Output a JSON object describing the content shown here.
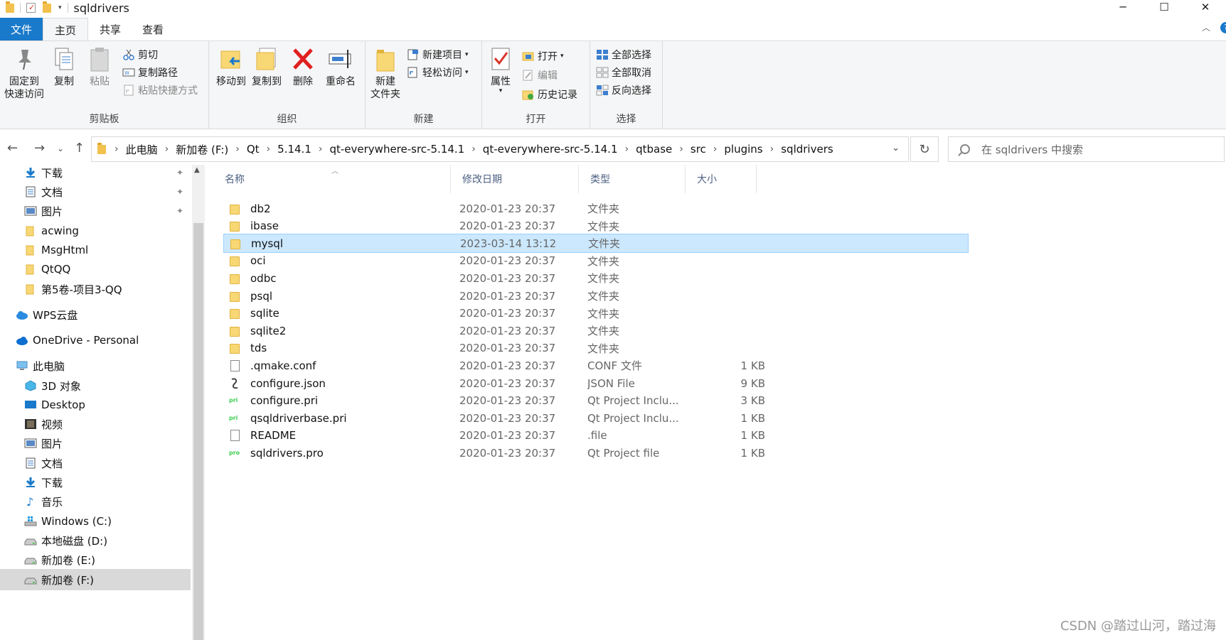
{
  "window": {
    "title": "sqldrivers",
    "minimize_glyph": "─",
    "maximize_glyph": "☐",
    "close_glyph": "✕"
  },
  "ribbon_tabs": [
    {
      "label": "文件"
    },
    {
      "label": "主页"
    },
    {
      "label": "共享"
    },
    {
      "label": "查看"
    }
  ],
  "ribbon": {
    "clipboard": {
      "label": "剪贴板",
      "pin_line1": "固定到",
      "pin_line2": "快速访问",
      "copy": "复制",
      "paste": "粘贴",
      "cut": "剪切",
      "copy_path": "复制路径",
      "paste_shortcut": "粘贴快捷方式"
    },
    "organize": {
      "label": "组织",
      "move_to": "移动到",
      "copy_to": "复制到",
      "delete": "删除",
      "rename": "重命名"
    },
    "new": {
      "label": "新建",
      "new_folder_line1": "新建",
      "new_folder_line2": "文件夹",
      "new_item": "新建项目",
      "easy_access": "轻松访问"
    },
    "open": {
      "label": "打开",
      "properties": "属性",
      "open": "打开",
      "edit": "编辑",
      "history": "历史记录"
    },
    "select": {
      "label": "选择",
      "select_all": "全部选择",
      "select_none": "全部取消",
      "invert": "反向选择"
    }
  },
  "address": {
    "crumbs": [
      "此电脑",
      "新加卷 (F:)",
      "Qt",
      "5.14.1",
      "qt-everywhere-src-5.14.1",
      "qt-everywhere-src-5.14.1",
      "qtbase",
      "src",
      "plugins",
      "sqldrivers"
    ]
  },
  "search": {
    "placeholder": "在 sqldrivers 中搜索"
  },
  "nav_pane": [
    {
      "label": "下载",
      "icon": "download-icon",
      "pinned": true
    },
    {
      "label": "文档",
      "icon": "document-icon",
      "pinned": true
    },
    {
      "label": "图片",
      "icon": "picture-icon",
      "pinned": true
    },
    {
      "label": "acwing",
      "icon": "folder-icon",
      "pinned": false
    },
    {
      "label": "MsgHtml",
      "icon": "folder-icon",
      "pinned": false
    },
    {
      "label": "QtQQ",
      "icon": "folder-icon",
      "pinned": false
    },
    {
      "label": "第5卷-项目3-QQ",
      "icon": "folder-icon",
      "pinned": false
    },
    {
      "label": "WPS云盘",
      "icon": "cloud-icon",
      "pinned": false
    },
    {
      "label": "OneDrive - Personal",
      "icon": "onedrive-icon",
      "pinned": false
    },
    {
      "label": "此电脑",
      "icon": "computer-icon",
      "pinned": false
    },
    {
      "label": "3D 对象",
      "icon": "3d-objects-icon",
      "pinned": false
    },
    {
      "label": "Desktop",
      "icon": "desktop-icon",
      "pinned": false
    },
    {
      "label": "视频",
      "icon": "video-icon",
      "pinned": false
    },
    {
      "label": "图片",
      "icon": "picture-icon",
      "pinned": false
    },
    {
      "label": "文档",
      "icon": "document-icon",
      "pinned": false
    },
    {
      "label": "下载",
      "icon": "download-icon",
      "pinned": false
    },
    {
      "label": "音乐",
      "icon": "music-icon",
      "pinned": false
    },
    {
      "label": "Windows (C:)",
      "icon": "windows-drive-icon",
      "pinned": false
    },
    {
      "label": "本地磁盘 (D:)",
      "icon": "drive-icon",
      "pinned": false
    },
    {
      "label": "新加卷 (E:)",
      "icon": "drive-icon",
      "pinned": false
    },
    {
      "label": "新加卷 (F:)",
      "icon": "drive-icon",
      "pinned": false
    }
  ],
  "columns": {
    "name": "名称",
    "date": "修改日期",
    "type": "类型",
    "size": "大小"
  },
  "files": [
    {
      "name": "db2",
      "date": "2020-01-23 20:37",
      "type": "文件夹",
      "size": "",
      "icon": "folder-icon"
    },
    {
      "name": "ibase",
      "date": "2020-01-23 20:37",
      "type": "文件夹",
      "size": "",
      "icon": "folder-icon"
    },
    {
      "name": "mysql",
      "date": "2023-03-14 13:12",
      "type": "文件夹",
      "size": "",
      "icon": "folder-icon"
    },
    {
      "name": "oci",
      "date": "2020-01-23 20:37",
      "type": "文件夹",
      "size": "",
      "icon": "folder-icon"
    },
    {
      "name": "odbc",
      "date": "2020-01-23 20:37",
      "type": "文件夹",
      "size": "",
      "icon": "folder-icon"
    },
    {
      "name": "psql",
      "date": "2020-01-23 20:37",
      "type": "文件夹",
      "size": "",
      "icon": "folder-icon"
    },
    {
      "name": "sqlite",
      "date": "2020-01-23 20:37",
      "type": "文件夹",
      "size": "",
      "icon": "folder-icon"
    },
    {
      "name": "sqlite2",
      "date": "2020-01-23 20:37",
      "type": "文件夹",
      "size": "",
      "icon": "folder-icon"
    },
    {
      "name": "tds",
      "date": "2020-01-23 20:37",
      "type": "文件夹",
      "size": "",
      "icon": "folder-icon"
    },
    {
      "name": ".qmake.conf",
      "date": "2020-01-23 20:37",
      "type": "CONF 文件",
      "size": "1 KB",
      "icon": "file-icon"
    },
    {
      "name": "configure.json",
      "date": "2020-01-23 20:37",
      "type": "JSON File",
      "size": "9 KB",
      "icon": "json-file-icon"
    },
    {
      "name": "configure.pri",
      "date": "2020-01-23 20:37",
      "type": "Qt Project Inclu...",
      "size": "3 KB",
      "icon": "pri-file-icon"
    },
    {
      "name": "qsqldriverbase.pri",
      "date": "2020-01-23 20:37",
      "type": "Qt Project Inclu...",
      "size": "1 KB",
      "icon": "pri-file-icon"
    },
    {
      "name": "README",
      "date": "2020-01-23 20:37",
      "type": ".file",
      "size": "1 KB",
      "icon": "file-icon"
    },
    {
      "name": "sqldrivers.pro",
      "date": "2020-01-23 20:37",
      "type": "Qt Project file",
      "size": "1 KB",
      "icon": "pro-file-icon"
    }
  ],
  "selected_file": "mysql",
  "watermark": "CSDN @踏过山河，踏过海",
  "colors": {
    "accent": "#1979ca",
    "selection": "#cce8ff",
    "folder": "#f8d775"
  }
}
